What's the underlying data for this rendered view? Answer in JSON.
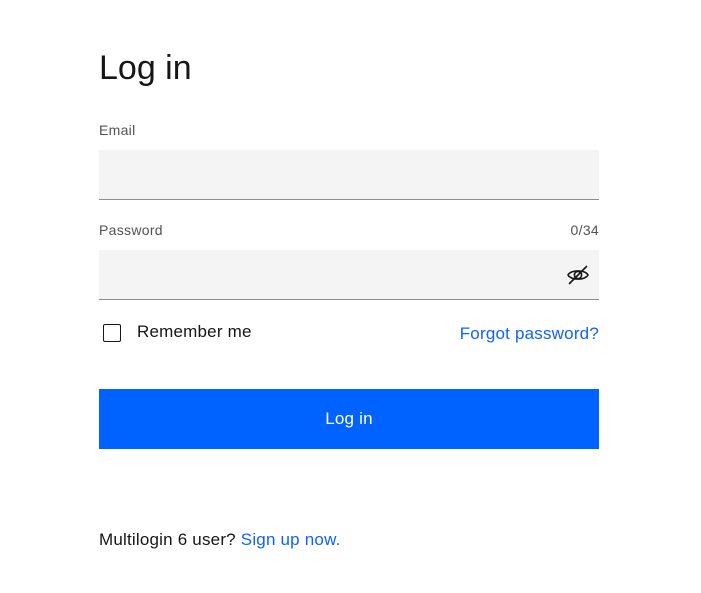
{
  "login": {
    "title": "Log in",
    "email": {
      "label": "Email",
      "value": "",
      "placeholder": ""
    },
    "password": {
      "label": "Password",
      "counter": "0/34",
      "value": "",
      "placeholder": "",
      "toggle_icon": "eye-off-icon"
    },
    "remember_me": {
      "label": "Remember me",
      "checked": false
    },
    "forgot_password_label": "Forgot password?",
    "submit_label": "Log in",
    "signup": {
      "prompt": "Multilogin 6 user?",
      "link_label": "Sign up now."
    }
  },
  "colors": {
    "accent": "#0062ff",
    "link": "#0f62fe",
    "field_background": "#f4f4f4",
    "text": "#161616",
    "label": "#525252"
  }
}
